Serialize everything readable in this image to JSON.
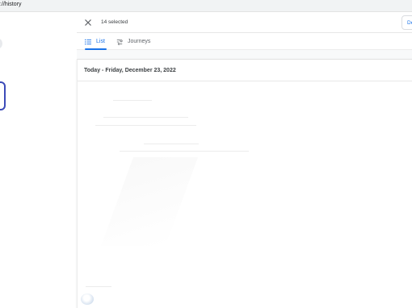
{
  "browser": {
    "url": "://history"
  },
  "selection_toolbar": {
    "close_icon": "close-icon",
    "selected_text": "14 selected",
    "delete_label": "De"
  },
  "tabs": [
    {
      "label": "List",
      "icon": "list-icon",
      "active": true
    },
    {
      "label": "Journeys",
      "icon": "journeys-icon",
      "active": false
    }
  ],
  "history": {
    "date_heading": "Today - Friday, December 23, 2022"
  },
  "colors": {
    "accent": "#1a73e8",
    "focus_ring": "#3c4bb8",
    "text_primary": "#202124",
    "text_secondary": "#5f6368"
  }
}
